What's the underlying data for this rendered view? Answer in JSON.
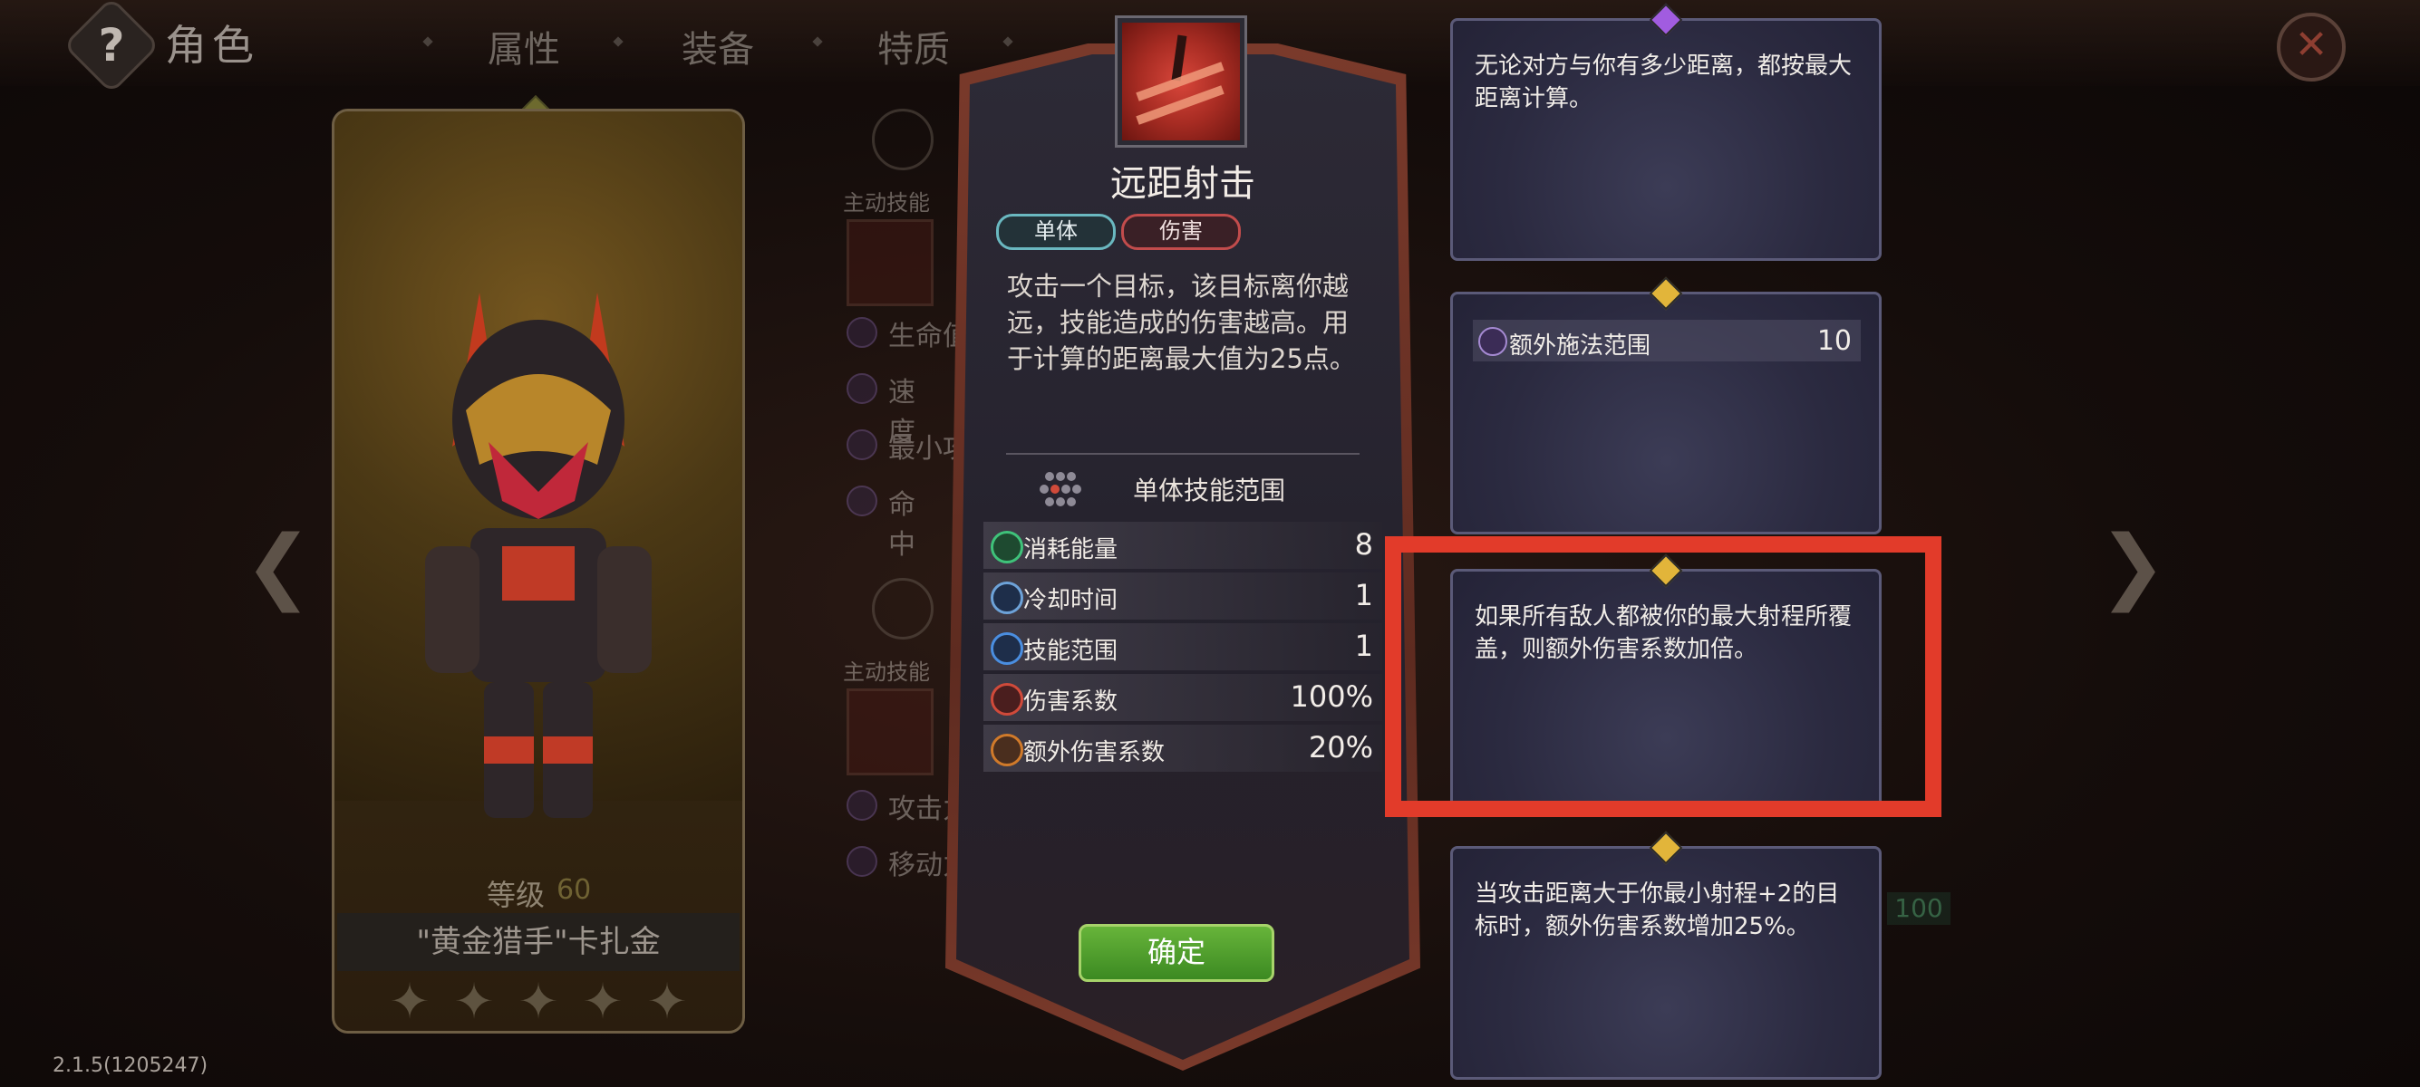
{
  "header": {
    "back_icon": "question-icon",
    "title": "角色",
    "tabs": [
      "属性",
      "装备",
      "特质"
    ],
    "close_icon": "close-x-icon"
  },
  "hero": {
    "level_label": "等级",
    "level_value": "60",
    "name": "\"黄金猎手\"卡扎金",
    "stars": 5
  },
  "behind_panel": {
    "active_skill_label_1": "主动技能",
    "active_skill_label_2": "主动技能",
    "stats_1": [
      "生命值",
      "速度",
      "最小攻",
      "命中"
    ],
    "stats_2": [
      "攻击力",
      "移动力"
    ]
  },
  "skill": {
    "name": "远距射击",
    "tags": [
      "单体",
      "伤害"
    ],
    "description": "攻击一个目标，该目标离你越远，技能造成的伤害越高。用于计算的距离最大值为25点。",
    "range_label": "单体技能范围",
    "stats": [
      {
        "label": "消耗能量",
        "value": "8",
        "color": "#3fc27a"
      },
      {
        "label": "冷却时间",
        "value": "1",
        "color": "#6da2d8"
      },
      {
        "label": "技能范围",
        "value": "1",
        "color": "#4a8ee0"
      },
      {
        "label": "伤害系数",
        "value": "100%",
        "color": "#d04a3a"
      },
      {
        "label": "额外伤害系数",
        "value": "20%",
        "color": "#d07a2a"
      }
    ],
    "confirm_label": "确定"
  },
  "traits": [
    {
      "text": "无论对方与你有多少距离，都按最大距离计算。",
      "gem_color": "#a15ce0"
    },
    {
      "param_label": "额外施法范围",
      "param_value": "10",
      "gem_color": "#e2b53a"
    },
    {
      "text": "如果所有敌人都被你的最大射程所覆盖，则额外伤害系数加倍。",
      "gem_color": "#e2b53a"
    },
    {
      "text": "当攻击距离大于你最小射程+2的目标时，额外伤害系数增加25%。",
      "gem_color": "#e2b53a"
    }
  ],
  "side_badge": "100",
  "version": "2.1.5(1205247)",
  "colors": {
    "highlight": "#e23b2a",
    "confirm": "#4fa02c"
  }
}
